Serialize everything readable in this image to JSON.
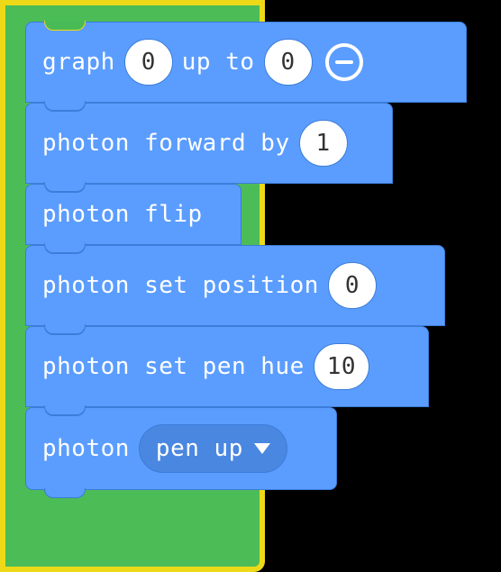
{
  "blocks": {
    "graph": {
      "label_a": "graph",
      "val_a": "0",
      "label_b": "up to",
      "val_b": "0"
    },
    "forward": {
      "label": "photon forward by",
      "val": "1"
    },
    "flip": {
      "label": "photon flip"
    },
    "setpos": {
      "label": "photon set position",
      "val": "0"
    },
    "sethue": {
      "label": "photon set pen hue",
      "val": "10"
    },
    "pen": {
      "label": "photon",
      "dropdown": "pen up"
    }
  }
}
